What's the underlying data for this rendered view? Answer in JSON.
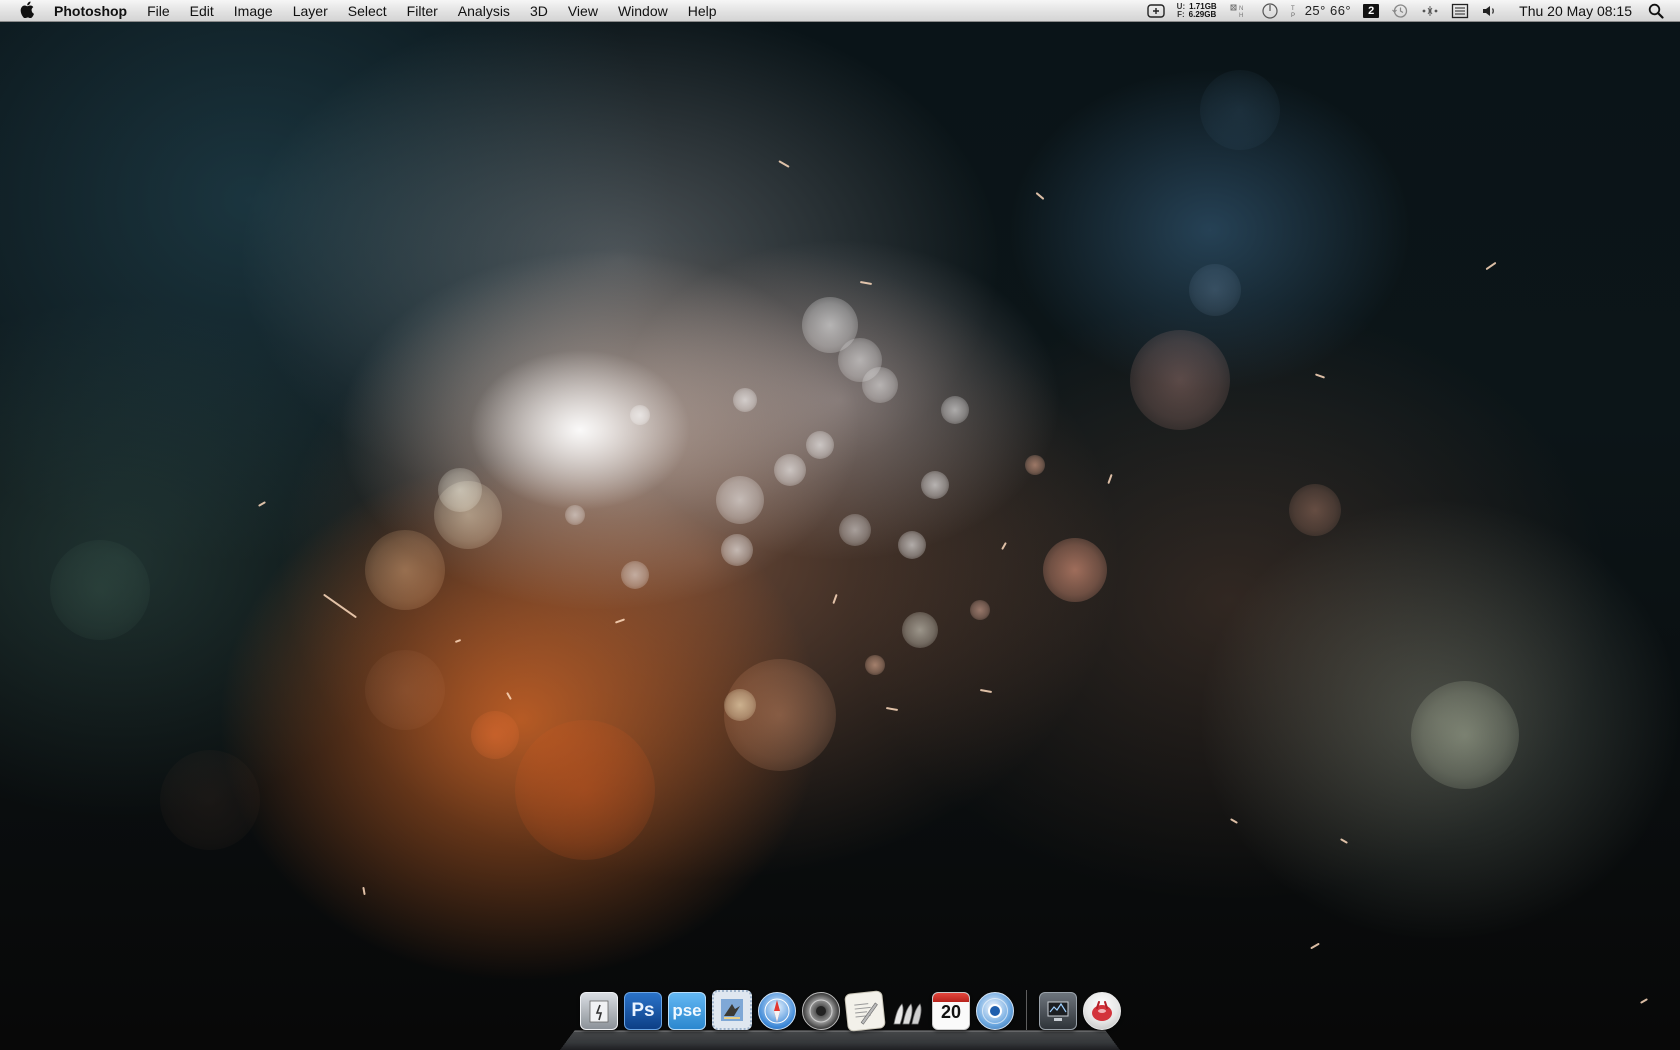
{
  "menubar": {
    "app_name": "Photoshop",
    "menus": [
      "File",
      "Edit",
      "Image",
      "Layer",
      "Select",
      "Filter",
      "Analysis",
      "3D",
      "View",
      "Window",
      "Help"
    ],
    "status": {
      "memory_used_label": "U:",
      "memory_used": "1.71GB",
      "memory_free_label": "F:",
      "memory_free": "6.29GB",
      "temperatures": "25° 66°",
      "spaces_number": "2",
      "clock": "Thu 20 May  08:15"
    },
    "icons": [
      "apple-icon",
      "add-box-icon",
      "memory-meter-icon",
      "disk-activity-icon",
      "cpu-dial-icon",
      "spaces-icon",
      "time-machine-icon",
      "bluetooth-dots-icon",
      "keyboard-menu-icon",
      "volume-icon",
      "spotlight-icon"
    ]
  },
  "dock": {
    "items": [
      {
        "name": "finder-folder-icon"
      },
      {
        "name": "photoshop-icon",
        "label": "Ps"
      },
      {
        "name": "photoshop-elements-icon",
        "label": "pse"
      },
      {
        "name": "mail-stamp-icon"
      },
      {
        "name": "safari-compass-icon"
      },
      {
        "name": "speaker-icon"
      },
      {
        "name": "textedit-icon"
      },
      {
        "name": "scripts-icon"
      },
      {
        "name": "ical-icon",
        "label": "20"
      },
      {
        "name": "chrome-icon"
      },
      {
        "name": "system-monitor-icon"
      },
      {
        "name": "trash-icon"
      }
    ]
  },
  "colors": {
    "menubar_top": "#f6f6f6",
    "menubar_bottom": "#d4d4d4",
    "wallpaper_base": "#0a1418",
    "wallpaper_warm": "#e66e28"
  }
}
